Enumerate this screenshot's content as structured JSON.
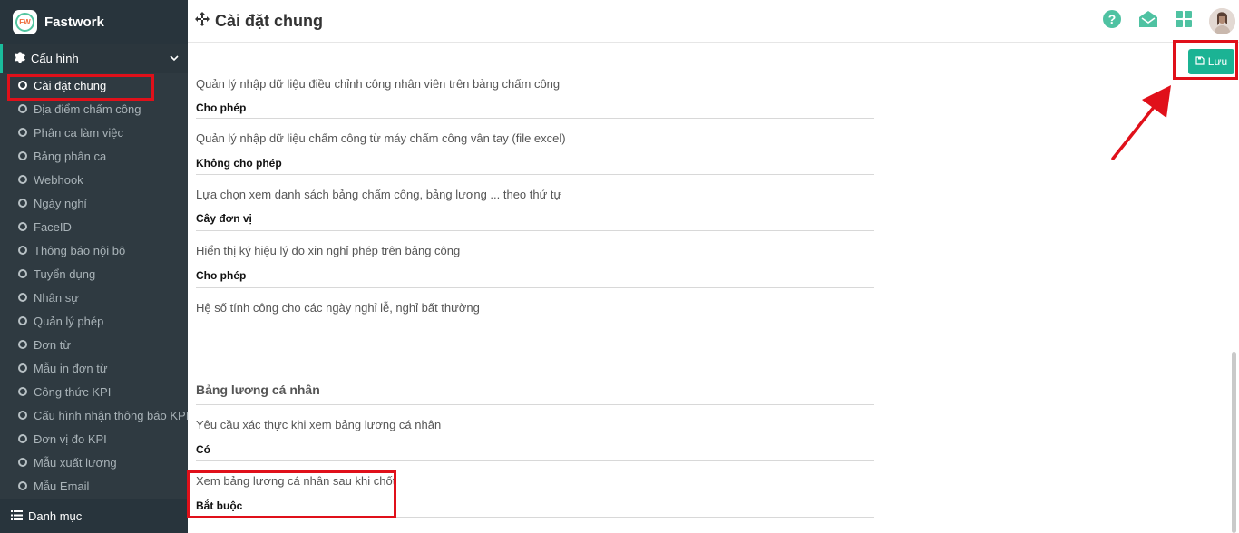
{
  "brand": {
    "name": "Fastwork",
    "logo_text": "FW"
  },
  "sidebar": {
    "section_label": "Cấu hình",
    "items": [
      {
        "label": "Cài đặt chung",
        "active": true
      },
      {
        "label": "Địa điểm chấm công"
      },
      {
        "label": "Phân ca làm việc"
      },
      {
        "label": "Bảng phân ca"
      },
      {
        "label": "Webhook"
      },
      {
        "label": "Ngày nghỉ"
      },
      {
        "label": "FaceID"
      },
      {
        "label": "Thông báo nội bộ"
      },
      {
        "label": "Tuyển dụng"
      },
      {
        "label": "Nhân sự"
      },
      {
        "label": "Quản lý phép"
      },
      {
        "label": "Đơn từ"
      },
      {
        "label": "Mẫu in đơn từ"
      },
      {
        "label": "Công thức KPI"
      },
      {
        "label": "Cấu hình nhận thông báo KPI"
      },
      {
        "label": "Đơn vị đo KPI"
      },
      {
        "label": "Mẫu xuất lương"
      },
      {
        "label": "Mẫu Email"
      }
    ],
    "footer_label": "Danh mục"
  },
  "header": {
    "title": "Cài đặt chung"
  },
  "toolbar": {
    "save_label": "Lưu"
  },
  "settings": [
    {
      "question": "Quản lý nhập dữ liệu điều chỉnh công nhân viên trên bảng chấm công",
      "answer": "Cho phép"
    },
    {
      "question": "Quản lý nhập dữ liệu chấm công từ máy chấm công vân tay (file excel)",
      "answer": "Không cho phép"
    },
    {
      "question": "Lựa chọn xem danh sách bảng chấm công, bảng lương ... theo thứ tự",
      "answer": "Cây đơn vị"
    },
    {
      "question": "Hiển thị ký hiệu lý do xin nghỉ phép trên bảng công",
      "answer": "Cho phép"
    },
    {
      "question": "Hệ số tính công cho các ngày nghỉ lễ, nghỉ bất thường",
      "answer": ""
    }
  ],
  "payslip": {
    "title": "Bảng lương cá nhân",
    "settings": [
      {
        "question": "Yêu cầu xác thực khi xem bảng lương cá nhân",
        "answer": "Có"
      },
      {
        "question": "Xem bảng lương cá nhân sau khi chốt",
        "answer": "Bắt buộc"
      }
    ]
  },
  "colors": {
    "accent": "#1bb394",
    "sidebar": "#2f3a41",
    "highlight": "#e0101a"
  }
}
